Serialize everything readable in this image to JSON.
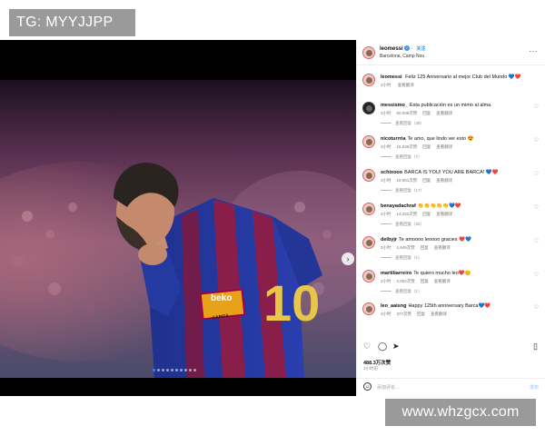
{
  "watermark_top": "TG: MYYJJPP",
  "watermark_bottom": "www.whzgcx.com",
  "post": {
    "username": "leomessi",
    "follow": "关注",
    "location": "Barcelona, Camp Nou",
    "caption_user": "leomessi",
    "caption": "Feliz 125 Aniversario al mejor Club del Mundo 💙❤️",
    "caption_time": "3小时",
    "caption_translate": "查看翻译",
    "likes": "488.3万次赞",
    "time": "3小时前",
    "add_comment_placeholder": "添加评论…",
    "post_label": "发布",
    "carousel_slides": 10,
    "carousel_active": 0
  },
  "comments": [
    {
      "user": "messismo_",
      "text": "Esta publicación es un mimo al alma.",
      "time": "3小时",
      "likes": "60,099次赞",
      "reply": "回复",
      "translate": "查看翻译",
      "replies": "查看回复（38）"
    },
    {
      "user": "nicoturrria",
      "text": "Te amo, que lindo ver esto 😍",
      "time": "3小时",
      "likes": "16,630次赞",
      "reply": "回复",
      "translate": "查看翻译",
      "replies": "查看回复（7）"
    },
    {
      "user": "schixooo",
      "text": "BARCA IS YOU! YOU ARE BARCA! 💙❤️",
      "time": "3小时",
      "likes": "19,951次赞",
      "reply": "回复",
      "translate": "查看翻译",
      "replies": "查看回复（17）"
    },
    {
      "user": "benayadachraf",
      "text": "👏👏👏👏👏💙❤️",
      "time": "3小时",
      "likes": "14,322次赞",
      "reply": "回复",
      "translate": "查看翻译",
      "replies": "查看回复（32）"
    },
    {
      "user": "deibyjr",
      "text": "Te amoooo leoooo gracies ❤️💙",
      "time": "3小时",
      "likes": "1,949次赞",
      "reply": "回复",
      "translate": "查看翻译",
      "replies": "查看回复（1）"
    },
    {
      "user": "martibarreiro",
      "text": "Te quiero mucho leo❤️😊",
      "time": "3小时",
      "likes": "2,052次赞",
      "reply": "回复",
      "translate": "查看翻译",
      "replies": "查看回复（1）"
    },
    {
      "user": "leo_aaisng",
      "text": "Happy 125th anniversary Barca💙❤️",
      "time": "3小时",
      "likes": "377次赞",
      "reply": "回复",
      "translate": "查看翻译",
      "replies": ""
    }
  ],
  "photo_text": {
    "sponsor": "beko",
    "number": "10",
    "armband": "CAPITÀ"
  },
  "icons": {
    "like": "heart-icon",
    "comment": "comment-icon",
    "share": "send-icon",
    "save": "bookmark-icon",
    "more": "more-icon",
    "verified": "verified-badge-icon",
    "next": "chevron-right-icon",
    "emoji": "smiley-icon"
  },
  "colors": {
    "instagram_blue": "#3897f0",
    "barca_blue": "#1f3a8f",
    "barca_red": "#a50044"
  }
}
